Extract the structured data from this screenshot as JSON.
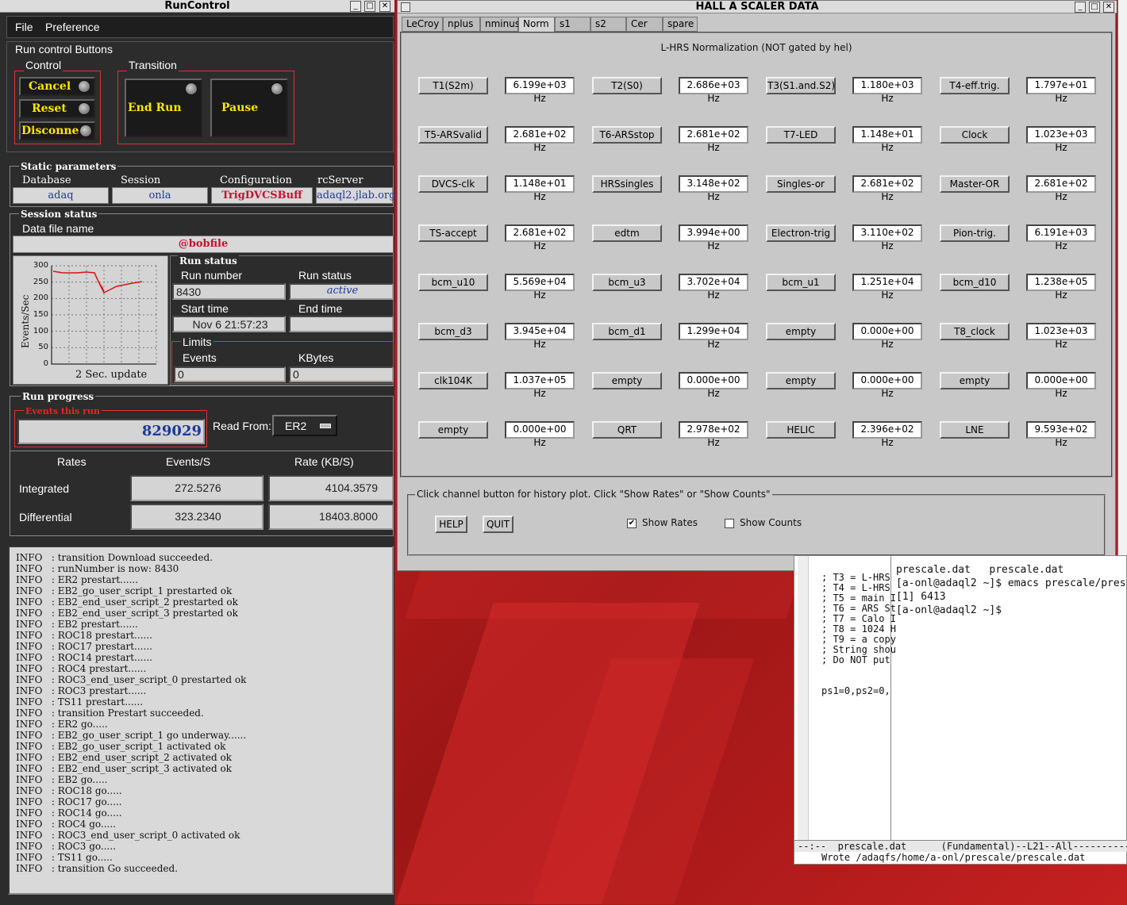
{
  "runcontrol": {
    "title": "RunControl",
    "menu": {
      "file": "File",
      "preference": "Preference"
    },
    "run_control_buttons_label": "Run control Buttons",
    "control_label": "Control",
    "transition_label": "Transition",
    "buttons": {
      "cancel": "Cancel",
      "reset": "Reset",
      "disconnect": "Disconnect",
      "end_run": "End Run",
      "pause": "Pause"
    },
    "static_params_label": "Static parameters",
    "static": {
      "database_label": "Database",
      "database": "adaq",
      "session_label": "Session",
      "session": "onla",
      "configuration_label": "Configuration",
      "configuration": "TrigDVCSBuff",
      "rcserver_label": "rcServer",
      "rcserver": "adaql2.jlab.org"
    },
    "session_status_label": "Session status",
    "data_file_label": "Data file name",
    "data_file": "@bobfile",
    "graph": {
      "ylabel": "Events/Sec",
      "caption": "2 Sec. update",
      "ticks": [
        "300",
        "250",
        "200",
        "150",
        "100",
        "50",
        "0"
      ]
    },
    "run_status_group": "Run status",
    "run_number_label": "Run number",
    "run_number": "8430",
    "run_status_label": "Run status",
    "run_status": "active",
    "start_time_label": "Start time",
    "start_time": "Nov 6 21:57:23",
    "end_time_label": "End time",
    "end_time": "",
    "limits_label": "Limits",
    "events_label": "Events",
    "events_limit": "0",
    "kbytes_label": "KBytes",
    "kbytes_limit": "0",
    "run_progress_label": "Run progress",
    "events_this_run_label": "Events this run",
    "events_this_run": "829029",
    "read_from_label": "Read From:",
    "read_from": "ER2",
    "rates": {
      "hdr_rates": "Rates",
      "hdr_events": "Events/S",
      "hdr_rate": "Rate (KB/S)",
      "integrated_label": "Integrated",
      "integrated_events": "272.5276",
      "integrated_rate": "4104.3579",
      "differential_label": "Differential",
      "differential_events": "323.2340",
      "differential_rate": "18403.8000"
    },
    "log": [
      "INFO   : transition Download succeeded.",
      "INFO   : runNumber is now: 8430",
      "INFO   : ER2 prestart......",
      "INFO   : EB2_go_user_script_1 prestarted ok",
      "INFO   : EB2_end_user_script_2 prestarted ok",
      "INFO   : EB2_end_user_script_3 prestarted ok",
      "INFO   : EB2 prestart......",
      "INFO   : ROC18 prestart......",
      "INFO   : ROC17 prestart......",
      "INFO   : ROC14 prestart......",
      "INFO   : ROC4 prestart......",
      "INFO   : ROC3_end_user_script_0 prestarted ok",
      "INFO   : ROC3 prestart......",
      "INFO   : TS11 prestart......",
      "INFO   : transition Prestart succeeded.",
      "INFO   : ER2 go.....",
      "INFO   : EB2_go_user_script_1 go underway......",
      "INFO   : EB2_go_user_script_1 activated ok",
      "INFO   : EB2_end_user_script_2 activated ok",
      "INFO   : EB2_end_user_script_3 activated ok",
      "INFO   : EB2 go.....",
      "INFO   : ROC18 go.....",
      "INFO   : ROC17 go.....",
      "INFO   : ROC14 go.....",
      "INFO   : ROC4 go.....",
      "INFO   : ROC3_end_user_script_0 activated ok",
      "INFO   : ROC3 go.....",
      "INFO   : TS11 go.....",
      "INFO   : transition Go succeeded."
    ]
  },
  "scaler": {
    "title": "HALL  A  SCALER  DATA",
    "tabs": [
      "LeCroy",
      "nplus",
      "nminus",
      "Norm",
      "s1",
      "s2",
      "Cer",
      "spare"
    ],
    "active_tab": "Norm",
    "heading": "L-HRS Normalization (NOT gated by hel)",
    "channels": [
      [
        [
          "T1(S2m)",
          "6.199e+03 Hz"
        ],
        [
          "T2(S0)",
          "2.686e+03 Hz"
        ],
        [
          "T3(S1.and.S2)",
          "1.180e+03 Hz"
        ],
        [
          "T4-eff.trig.",
          "1.797e+01 Hz"
        ]
      ],
      [
        [
          "T5-ARSvalid",
          "2.681e+02 Hz"
        ],
        [
          "T6-ARSstop",
          "2.681e+02 Hz"
        ],
        [
          "T7-LED",
          "1.148e+01 Hz"
        ],
        [
          "Clock",
          "1.023e+03 Hz"
        ]
      ],
      [
        [
          "DVCS-clk",
          "1.148e+01 Hz"
        ],
        [
          "HRSsingles",
          "3.148e+02 Hz"
        ],
        [
          "Singles-or",
          "2.681e+02 Hz"
        ],
        [
          "Master-OR",
          "2.681e+02 Hz"
        ]
      ],
      [
        [
          "TS-accept",
          "2.681e+02 Hz"
        ],
        [
          "edtm",
          "3.994e+00 Hz"
        ],
        [
          "Electron-trig",
          "3.110e+02 Hz"
        ],
        [
          "Pion-trig.",
          "6.191e+03 Hz"
        ]
      ],
      [
        [
          "bcm_u10",
          "5.569e+04 Hz"
        ],
        [
          "bcm_u3",
          "3.702e+04 Hz"
        ],
        [
          "bcm_u1",
          "1.251e+04 Hz"
        ],
        [
          "bcm_d10",
          "1.238e+05 Hz"
        ]
      ],
      [
        [
          "bcm_d3",
          "3.945e+04 Hz"
        ],
        [
          "bcm_d1",
          "1.299e+04 Hz"
        ],
        [
          "empty",
          "0.000e+00 Hz"
        ],
        [
          "T8_clock",
          "1.023e+03 Hz"
        ]
      ],
      [
        [
          "clk104K",
          "1.037e+05 Hz"
        ],
        [
          "empty",
          "0.000e+00 Hz"
        ],
        [
          "empty",
          "0.000e+00 Hz"
        ],
        [
          "empty",
          "0.000e+00 Hz"
        ]
      ],
      [
        [
          "empty",
          "0.000e+00 Hz"
        ],
        [
          "QRT",
          "2.978e+02 Hz"
        ],
        [
          "HELIC",
          "2.396e+02 Hz"
        ],
        [
          "LNE",
          "9.593e+02 Hz"
        ]
      ]
    ],
    "help_text": "Click channel button for history plot.  Click \"Show Rates\" or \"Show Counts\"",
    "help_button": "HELP",
    "quit_button": "QUIT",
    "show_rates": "Show Rates",
    "show_counts": "Show Counts",
    "show_rates_checked": true,
    "show_counts_checked": false
  },
  "terminal": {
    "left_lines": [
      "; T3 = L-HRS",
      "; T4 = L-HRS",
      "; T5 = main I",
      "; T6 = ARS St",
      "; T7 = Calo I",
      "; T8 = 1024 H",
      "; T9 = a copy",
      "; String shou",
      "; Do NOT put",
      "",
      "",
      "ps1=0,ps2=0,"
    ],
    "right_lines": [
      "prescale.dat   prescale.dat",
      "[a-onl@adaql2 ~]$ emacs prescale/pres",
      "[1] 6413",
      "[a-onl@adaql2 ~]$ "
    ],
    "modeline": "--:--  prescale.dat      (Fundamental)--L21--All----------",
    "echo": "Wrote /adaqfs/home/a-onl/prescale/prescale.dat"
  }
}
